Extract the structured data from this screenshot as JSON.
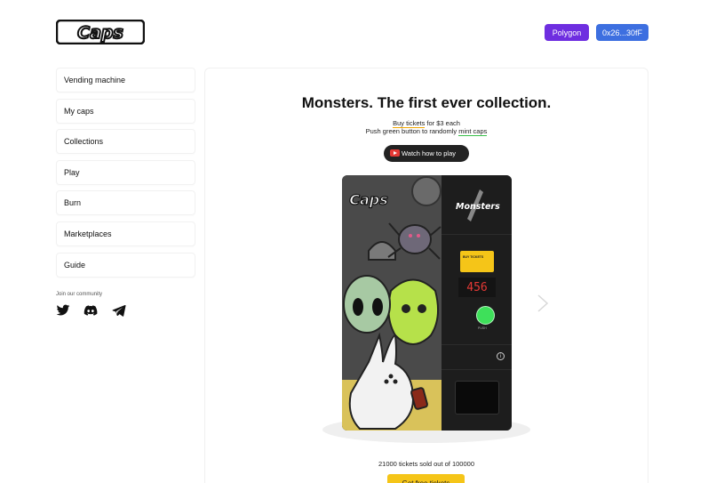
{
  "header": {
    "logo_text": "Caps",
    "network_label": "Polygon",
    "wallet_label": "0x26...30fF"
  },
  "sidebar": {
    "items": [
      {
        "label": "Vending machine"
      },
      {
        "label": "My caps"
      },
      {
        "label": "Collections"
      },
      {
        "label": "Play"
      },
      {
        "label": "Burn"
      },
      {
        "label": "Marketplaces"
      },
      {
        "label": "Guide"
      }
    ],
    "community_label": "Join our community",
    "social_icons": [
      "twitter-icon",
      "discord-icon",
      "telegram-icon"
    ]
  },
  "main": {
    "headline": "Monsters. The first ever collection.",
    "sub_line1": {
      "link": "Buy tickets",
      "rest": " for $3 each"
    },
    "sub_line2": {
      "prefix": "Push green button to randomly ",
      "link": "mint caps"
    },
    "watch_label": "Watch how to play",
    "machine": {
      "art_logo": "Caps",
      "console_title": "Monsters",
      "ticket_text": "BUY TICKETS",
      "counter_value": "456",
      "push_label": "PUSH"
    },
    "sold_text": "21000 tickets sold out of 100000",
    "free_button": "Get free tickets"
  },
  "colors": {
    "network_button": "#6e2ee0",
    "wallet_button": "#3d6fe0",
    "ticket_yellow": "#f5c518",
    "push_green": "#3ee05a",
    "counter_red": "#e53935"
  }
}
